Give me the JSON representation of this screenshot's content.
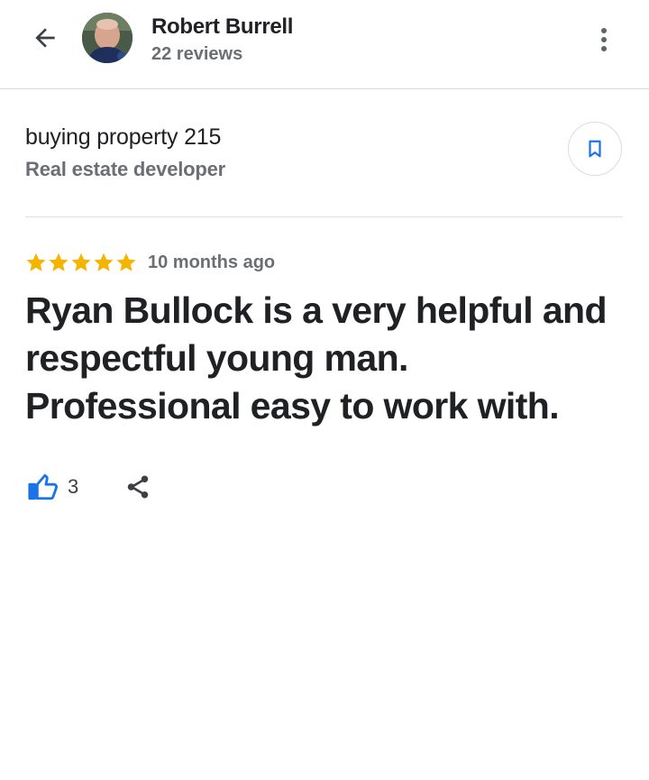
{
  "header": {
    "author_name": "Robert Burrell",
    "review_count": "22 reviews",
    "back_icon": "arrow-back-icon",
    "more_icon": "more-vert-icon"
  },
  "place": {
    "name": "buying property 215",
    "category": "Real estate developer",
    "save_icon": "bookmark-icon"
  },
  "review": {
    "rating": 5,
    "rating_max": 5,
    "time": "10 months ago",
    "text_lines": [
      "Ryan Bullock is a very helpful and",
      "respectful young man.",
      "Professional easy to work with."
    ]
  },
  "actions": {
    "like_count": "3",
    "like_icon": "thumbs-up-icon",
    "share_icon": "share-icon"
  },
  "colors": {
    "star": "#f4b400",
    "accent": "#1a73e8",
    "secondary_text": "#6b6f74"
  }
}
